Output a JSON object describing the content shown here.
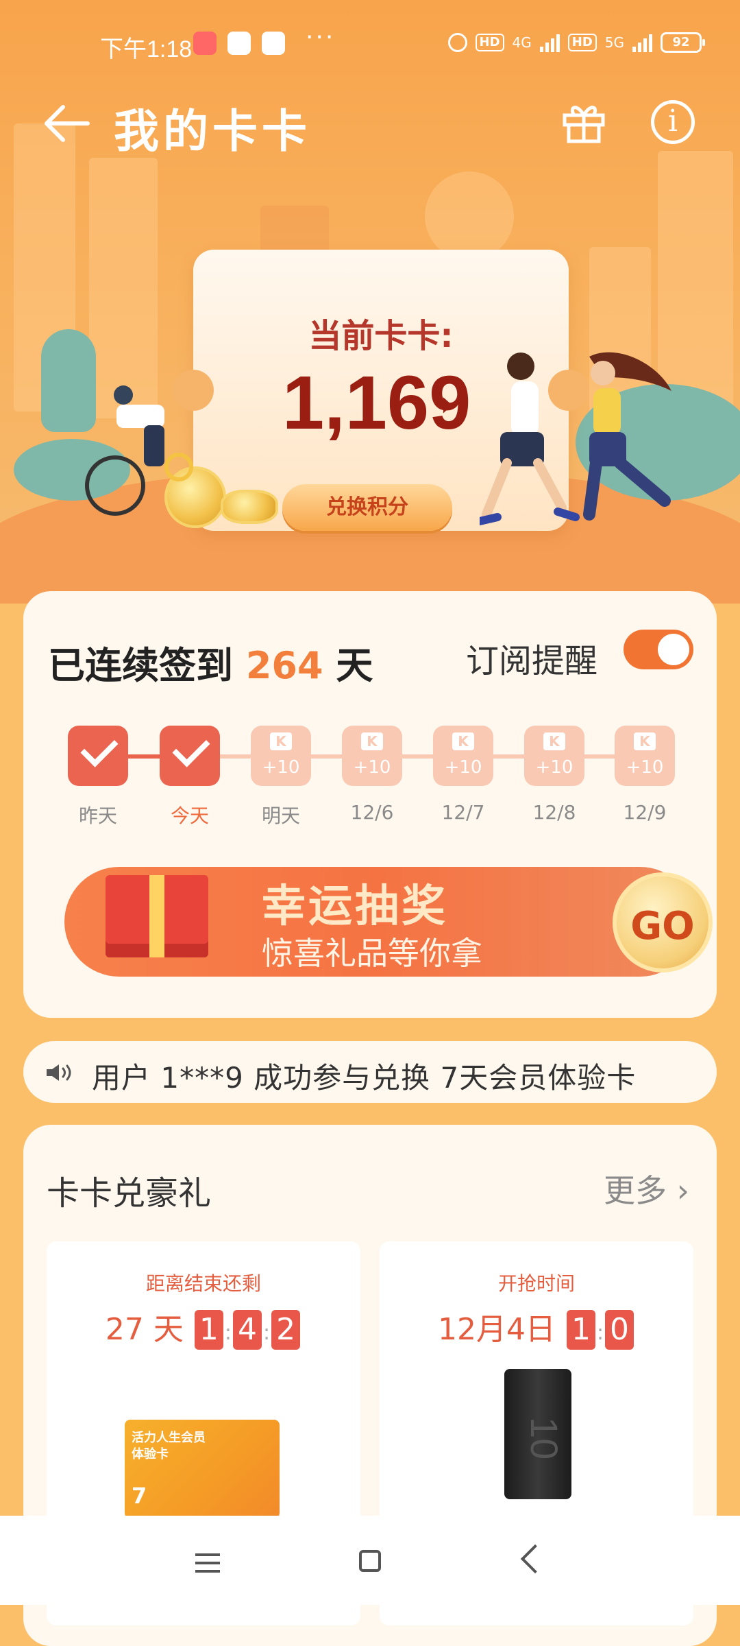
{
  "status_bar": {
    "time": "下午1:18",
    "battery": "92",
    "network1": "4G",
    "network2": "5G",
    "hd": "HD"
  },
  "header": {
    "title": "我的卡卡"
  },
  "balance": {
    "label": "当前卡卡:",
    "value": "1,169",
    "arrow": "›",
    "redeem_label": "兑换积分"
  },
  "checkin": {
    "streak_prefix": "已连续签到",
    "streak_days": "264",
    "streak_suffix": "天",
    "subscribe_label": "订阅提醒",
    "subscribe_on": true,
    "days": [
      {
        "label": "昨天",
        "checked": true
      },
      {
        "label": "今天",
        "checked": true
      },
      {
        "label": "明天",
        "checked": false,
        "points": "+10"
      },
      {
        "label": "12/6",
        "checked": false,
        "points": "+10"
      },
      {
        "label": "12/7",
        "checked": false,
        "points": "+10"
      },
      {
        "label": "12/8",
        "checked": false,
        "points": "+10"
      },
      {
        "label": "12/9",
        "checked": false,
        "points": "+10"
      }
    ],
    "k_icon": "K"
  },
  "lottery": {
    "title": "幸运抽奖",
    "subtitle": "惊喜礼品等你拿",
    "go_label": "GO"
  },
  "marquee": {
    "text": "用户 1***9 成功参与兑换 7天会员体验卡"
  },
  "exchange": {
    "title": "卡卡兑豪礼",
    "more_label": "更多",
    "products": [
      {
        "head": "距离结束还剩",
        "timer_text": "27 天",
        "blocks": [
          "1",
          "4",
          "2"
        ],
        "card_line1": "活力人生会员",
        "card_line2": "体验卡",
        "card_days": "7"
      },
      {
        "head": "开抢时间",
        "timer_text": "12月4日",
        "blocks": [
          "1",
          "0"
        ],
        "powerbank_text": "10"
      }
    ]
  },
  "colors": {
    "accent": "#f27433",
    "hero_bg": "#f8a44c",
    "streak_num": "#f2803c",
    "checked": "#ea6450"
  }
}
